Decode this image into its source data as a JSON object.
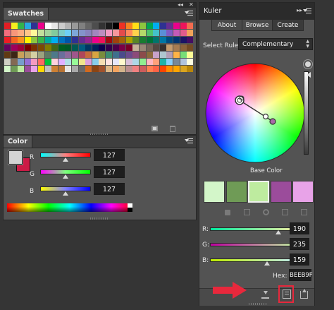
{
  "swatches_panel": {
    "title": "Swatches",
    "collapse_glyph": "◂◂",
    "close_glyph": "✕",
    "icons": [
      "new-swatch-icon",
      "trash-icon"
    ],
    "palette": {
      "row1": [
        "#e31e24",
        "#f7ed1f",
        "#33b34a",
        "#27aae1",
        "#2e3192",
        "#ec008c",
        "#ffffff",
        "#e6e6e6",
        "#cccccc",
        "#b3b3b3",
        "#999999",
        "#808080",
        "#666666",
        "#4d4d4d",
        "#333333",
        "#1a1a1a",
        "#000000",
        "#ee3124",
        "#f58220",
        "#ffde17",
        "#8dc63f",
        "#00a651",
        "#00aeef",
        "#2e3192",
        "#662d91",
        "#ec008c",
        "#ed145b",
        "#f26c4f"
      ],
      "row2": [
        "#f26d7d",
        "#f7977a",
        "#fbad82",
        "#fdc689",
        "#fff79a",
        "#c4df9b",
        "#a3d39c",
        "#82ca9d",
        "#7bcdc8",
        "#6ecff6",
        "#7ea7d8",
        "#8493ca",
        "#8882be",
        "#a187be",
        "#bc8dbf",
        "#f49ac2",
        "#f6989d",
        "#e34b4b",
        "#ff8a5c",
        "#ffd24d",
        "#b5d96a",
        "#4fc46a",
        "#44c2c9",
        "#5b8fd6",
        "#7f5bc4",
        "#c45bb7",
        "#e05c8c",
        "#f1a35a"
      ],
      "row3": [
        "#ed1c24",
        "#f26522",
        "#f7941d",
        "#fff200",
        "#8dc63f",
        "#39b54a",
        "#00a99d",
        "#00aeef",
        "#0072bc",
        "#0054a6",
        "#2e3192",
        "#662d91",
        "#92278f",
        "#ec008c",
        "#ed145b",
        "#9e0b0f",
        "#a0410d",
        "#a36209",
        "#aba000",
        "#598527",
        "#197b30",
        "#007236",
        "#00746b",
        "#0076a3",
        "#004a80",
        "#003471",
        "#1b1464",
        "#440e62"
      ],
      "row4": [
        "#630460",
        "#9e005d",
        "#9e0039",
        "#790000",
        "#7b2e00",
        "#7d4900",
        "#827b00",
        "#406618",
        "#005e20",
        "#005826",
        "#005952",
        "#005b7f",
        "#003663",
        "#002157",
        "#0d004c",
        "#32004b",
        "#4b0049",
        "#7b0046",
        "#7a0026",
        "#c7b299",
        "#998675",
        "#736357",
        "#534741",
        "#37302d",
        "#c69c6d",
        "#a67c52",
        "#8c6239",
        "#754c24"
      ],
      "row5": [
        "#603913",
        "#3c2415",
        "#c9a05a",
        "#b6a16f",
        "#d4cfa3",
        "#9ba37e",
        "#5f7a63",
        "#4e7a8a",
        "#6a6f9c",
        "#8e6a9c",
        "#a0578c",
        "#b0475a",
        "#c76b3a",
        "#d9a441",
        "#7a8c3d",
        "#3d8c6f",
        "#3f6f8c",
        "#4b4b8c",
        "#6b4b8c",
        "#8c4b7a",
        "#8c4b4b",
        "#8c6a3d",
        "#c8a2c8",
        "#aec6cf",
        "#b39eb5",
        "#ffb347",
        "#77dd77",
        "#fdfd96"
      ],
      "row6": [
        "#cfcfc4",
        "#836953",
        "#779ecb",
        "#966fd6",
        "#f49ac2",
        "#ff6961",
        "#03c03c",
        "#ffd1dc",
        "#e0b0ff",
        "#b0e0e6",
        "#98fb98",
        "#f0e68c",
        "#dda0dd",
        "#87ceeb",
        "#f5deb3",
        "#ffe4e1",
        "#e6e6fa",
        "#fffacd",
        "#d8bfd8",
        "#add8e6",
        "#90ee90",
        "#ffb6c1",
        "#ffa07a",
        "#20b2aa",
        "#87cefa",
        "#778899",
        "#b0c4de",
        "#ffffe0"
      ],
      "row7": [
        "#d3f6c9",
        "#6f9b56",
        "#bceb9f",
        "#9b4c9b",
        "#e8a3e8",
        "#ffd700",
        "#c0c0c0",
        "#cd7f32",
        "#b87333",
        "#e5e4e2",
        "#a9a9a9",
        "#696969",
        "#d2691e",
        "#8b4513",
        "#a0522d",
        "#deb887",
        "#f4a460",
        "#d2b48c",
        "#bc8f8f",
        "#f08080",
        "#cd5c5c",
        "#ff7f50",
        "#ff6347",
        "#ff4500",
        "#ff8c00",
        "#ffa500",
        "#daa520",
        "#b8860b"
      ]
    }
  },
  "color_panel": {
    "title": "Color",
    "foreground_color": "#d4d4d4",
    "background_color": "#cc1b46",
    "channels": [
      {
        "label": "R",
        "value": "127",
        "level": 0.5
      },
      {
        "label": "G",
        "value": "127",
        "level": 0.5
      },
      {
        "label": "B",
        "value": "127",
        "level": 0.5
      }
    ]
  },
  "kuler_panel": {
    "title": "Kuler",
    "tabs": [
      "About",
      "Browse",
      "Create"
    ],
    "active_tab": "Create",
    "select_rule_label": "Select Rule:",
    "select_rule_value": "Complementary",
    "base_color_label": "Base Color",
    "theme_colors": [
      "#d3f6c9",
      "#6f9b56",
      "#beeb9f",
      "#9b4c9b",
      "#e8a3e8"
    ],
    "sliders": [
      {
        "label": "R:",
        "value": "190",
        "level": 0.745
      },
      {
        "label": "G:",
        "value": "235",
        "level": 0.92
      },
      {
        "label": "B:",
        "value": "159",
        "level": 0.62
      }
    ],
    "hex_label": "Hex:",
    "hex_value": "BEEB9F",
    "bottom_icons": [
      "save-theme-icon",
      "add-to-swatches-icon",
      "upload-icon"
    ]
  },
  "annotation": {
    "arrow_color": "#e8283c",
    "highlight_color": "#e8283c"
  }
}
